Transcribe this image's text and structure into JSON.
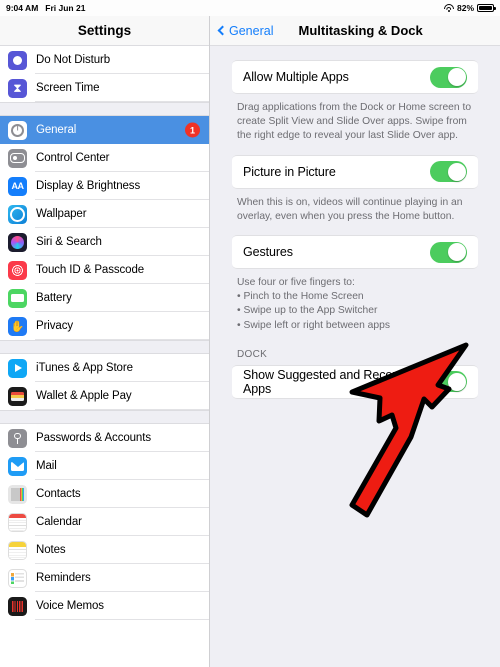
{
  "statusbar": {
    "time": "9:04 AM",
    "date": "Fri Jun 21",
    "battery_percent": "82%",
    "wifi_icon": "wifi-icon",
    "battery_icon": "battery-icon"
  },
  "sidebar": {
    "title": "Settings",
    "groups": [
      {
        "items": [
          {
            "label": "Do Not Disturb",
            "icon": "moon-icon",
            "icon_class": "ic-dnd",
            "glyph": "",
            "selected": false,
            "badge": ""
          },
          {
            "label": "Screen Time",
            "icon": "hourglass-icon",
            "icon_class": "ic-screentime",
            "glyph": "⧗",
            "selected": false,
            "badge": ""
          }
        ]
      },
      {
        "items": [
          {
            "label": "General",
            "icon": "gear-icon",
            "icon_class": "ic-general sel",
            "glyph": "",
            "selected": true,
            "badge": "1"
          },
          {
            "label": "Control Center",
            "icon": "sliders-icon",
            "icon_class": "ic-cc",
            "glyph": "",
            "selected": false,
            "badge": ""
          },
          {
            "label": "Display & Brightness",
            "icon": "display-icon",
            "icon_class": "ic-display",
            "glyph": "AA",
            "selected": false,
            "badge": ""
          },
          {
            "label": "Wallpaper",
            "icon": "wallpaper-icon",
            "icon_class": "ic-wallpaper",
            "glyph": "",
            "selected": false,
            "badge": ""
          },
          {
            "label": "Siri & Search",
            "icon": "siri-icon",
            "icon_class": "ic-siri",
            "glyph": "",
            "selected": false,
            "badge": ""
          },
          {
            "label": "Touch ID & Passcode",
            "icon": "fingerprint-icon",
            "icon_class": "ic-touchid",
            "glyph": "",
            "selected": false,
            "badge": ""
          },
          {
            "label": "Battery",
            "icon": "battery-icon",
            "icon_class": "ic-battery",
            "glyph": "",
            "selected": false,
            "badge": ""
          },
          {
            "label": "Privacy",
            "icon": "hand-icon",
            "icon_class": "ic-privacy",
            "glyph": "✋",
            "selected": false,
            "badge": ""
          }
        ]
      },
      {
        "items": [
          {
            "label": "iTunes & App Store",
            "icon": "app-store-icon",
            "icon_class": "ic-itunes",
            "glyph": "",
            "selected": false,
            "badge": ""
          },
          {
            "label": "Wallet & Apple Pay",
            "icon": "wallet-icon",
            "icon_class": "ic-wallet",
            "glyph": "",
            "selected": false,
            "badge": ""
          }
        ]
      },
      {
        "items": [
          {
            "label": "Passwords & Accounts",
            "icon": "key-icon",
            "icon_class": "ic-pw",
            "glyph": "",
            "selected": false,
            "badge": ""
          },
          {
            "label": "Mail",
            "icon": "mail-icon",
            "icon_class": "ic-mail",
            "glyph": "",
            "selected": false,
            "badge": ""
          },
          {
            "label": "Contacts",
            "icon": "contacts-icon",
            "icon_class": "ic-contacts",
            "glyph": "",
            "selected": false,
            "badge": ""
          },
          {
            "label": "Calendar",
            "icon": "calendar-icon",
            "icon_class": "ic-calendar",
            "glyph": "",
            "selected": false,
            "badge": ""
          },
          {
            "label": "Notes",
            "icon": "notes-icon",
            "icon_class": "ic-notes",
            "glyph": "",
            "selected": false,
            "badge": ""
          },
          {
            "label": "Reminders",
            "icon": "reminders-icon",
            "icon_class": "ic-reminders",
            "glyph": "",
            "selected": false,
            "badge": ""
          },
          {
            "label": "Voice Memos",
            "icon": "voice-memos-icon",
            "icon_class": "ic-voicememos",
            "glyph": "",
            "selected": false,
            "badge": ""
          }
        ]
      }
    ]
  },
  "detail": {
    "back_label": "General",
    "back_icon": "chevron-left-icon",
    "title": "Multitasking & Dock",
    "rows": {
      "allow_multiple_apps": {
        "label": "Allow Multiple Apps",
        "toggle": "on"
      },
      "allow_multiple_apps_note": "Drag applications from the Dock or Home screen to create Split View and Slide Over apps. Swipe from the right edge to reveal your last Slide Over app.",
      "picture_in_picture": {
        "label": "Picture in Picture",
        "toggle": "on"
      },
      "picture_in_picture_note": "When this is on, videos will continue playing in an overlay, even when you press the Home button.",
      "gestures": {
        "label": "Gestures",
        "toggle": "on"
      },
      "gestures_note_intro": "Use four or five fingers to:",
      "gestures_bullets": [
        "Pinch to the Home Screen",
        "Swipe up to the App Switcher",
        "Swipe left or right between apps"
      ],
      "dock_header": "DOCK",
      "show_suggested": {
        "label": "Show Suggested and Recent Apps",
        "toggle": "on"
      }
    }
  },
  "annotation": {
    "arrow_icon": "red-arrow-annotation",
    "color": "#ee1c12",
    "outline": "#000000"
  },
  "colors": {
    "accent_blue": "#147efb",
    "selected_row": "#4a90e2",
    "toggle_on": "#4ccc5e",
    "badge_red": "#f03226",
    "page_bg": "#efeff4"
  }
}
